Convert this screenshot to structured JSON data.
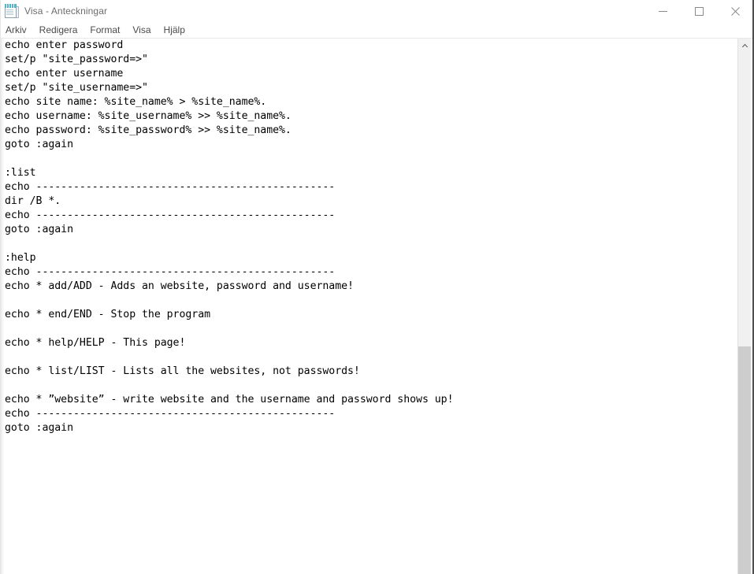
{
  "window": {
    "title": "Visa - Anteckningar",
    "icon": "notepad-icon"
  },
  "titlebar": {
    "minimize_label": "–",
    "maximize_label": "□",
    "close_label": "✕"
  },
  "menubar": {
    "items": [
      {
        "label": "Arkiv"
      },
      {
        "label": "Redigera"
      },
      {
        "label": "Format"
      },
      {
        "label": "Visa"
      },
      {
        "label": "Hjälp"
      }
    ]
  },
  "editor": {
    "lines": [
      "echo enter password",
      "set/p \"site_password=>\"",
      "echo enter username",
      "set/p \"site_username=>\"",
      "echo site name: %site_name% > %site_name%.",
      "echo username: %site_username% >> %site_name%.",
      "echo password: %site_password% >> %site_name%.",
      "goto :again",
      "",
      ":list",
      "echo ------------------------------------------------",
      "dir /B *.",
      "echo ------------------------------------------------",
      "goto :again",
      "",
      ":help",
      "echo ------------------------------------------------",
      "echo * add/ADD - Adds an website, password and username!",
      "",
      "echo * end/END - Stop the program",
      "",
      "echo * help/HELP - This page!",
      "",
      "echo * list/LIST - Lists all the websites, not passwords!",
      "",
      "echo * ”website” - write website and the username and password shows up!",
      "echo ------------------------------------------------",
      "goto :again"
    ]
  },
  "scrollbar": {
    "up_arrow": "chevron-up-icon",
    "thumb_position_percent": 58
  },
  "colors": {
    "window_background": "#ffffff",
    "title_text": "#6d6d6d",
    "menu_text": "#4a4a4a",
    "editor_text": "#000000",
    "scrollbar_track": "#f0f0f0",
    "scrollbar_thumb": "#cdcdcd",
    "window_border": "#4d4d4d"
  }
}
